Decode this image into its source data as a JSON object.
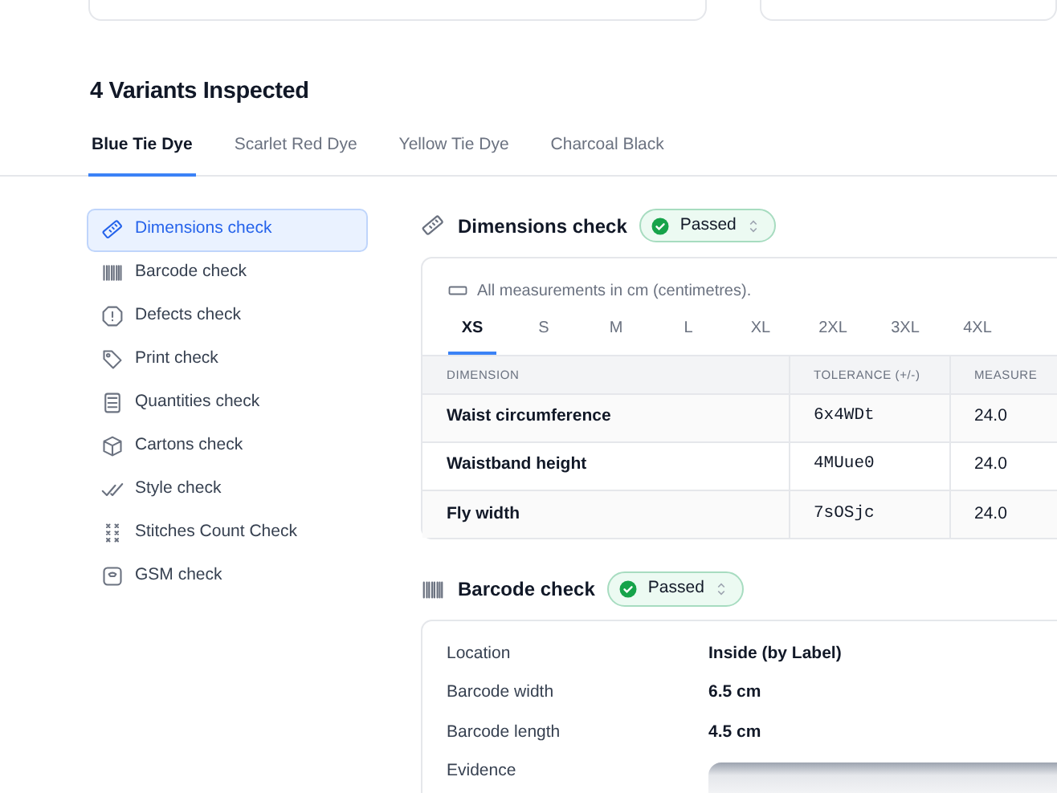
{
  "heading": "4 Variants Inspected",
  "variant_tabs": [
    {
      "label": "Blue Tie Dye",
      "selected": true
    },
    {
      "label": "Scarlet Red Dye",
      "selected": false
    },
    {
      "label": "Yellow Tie Dye",
      "selected": false
    },
    {
      "label": "Charcoal Black",
      "selected": false
    }
  ],
  "sidebar": {
    "items": [
      {
        "label": "Dimensions check",
        "selected": true
      },
      {
        "label": "Barcode check",
        "selected": false
      },
      {
        "label": "Defects check",
        "selected": false
      },
      {
        "label": "Print check",
        "selected": false
      },
      {
        "label": "Quantities check",
        "selected": false
      },
      {
        "label": "Cartons check",
        "selected": false
      },
      {
        "label": "Style check",
        "selected": false
      },
      {
        "label": "Stitches Count Check",
        "selected": false
      },
      {
        "label": "GSM check",
        "selected": false
      }
    ]
  },
  "dimensions_check": {
    "title": "Dimensions check",
    "status": "Passed",
    "note": "All measurements in cm (centimetres).",
    "size_tabs": [
      {
        "label": "XS",
        "selected": true
      },
      {
        "label": "S",
        "selected": false
      },
      {
        "label": "M",
        "selected": false
      },
      {
        "label": "L",
        "selected": false
      },
      {
        "label": "XL",
        "selected": false
      },
      {
        "label": "2XL",
        "selected": false
      },
      {
        "label": "3XL",
        "selected": false
      },
      {
        "label": "4XL",
        "selected": false
      }
    ],
    "table": {
      "columns": [
        "DIMENSION",
        "TOLERANCE (+/-)",
        "MEASURE"
      ],
      "rows": [
        [
          "Waist circumference",
          "6x4WDt",
          "24.0"
        ],
        [
          "Waistband height",
          "4MUue0",
          "24.0"
        ],
        [
          "Fly width",
          "7sOSjc",
          "24.0"
        ]
      ]
    }
  },
  "barcode_check": {
    "title": "Barcode check",
    "status": "Passed",
    "fields": [
      {
        "label": "Location",
        "value": "Inside (by Label)"
      },
      {
        "label": "Barcode width",
        "value": "6.5 cm"
      },
      {
        "label": "Barcode length",
        "value": "4.5 cm"
      },
      {
        "label": "Evidence",
        "kind": "photo"
      }
    ]
  }
}
